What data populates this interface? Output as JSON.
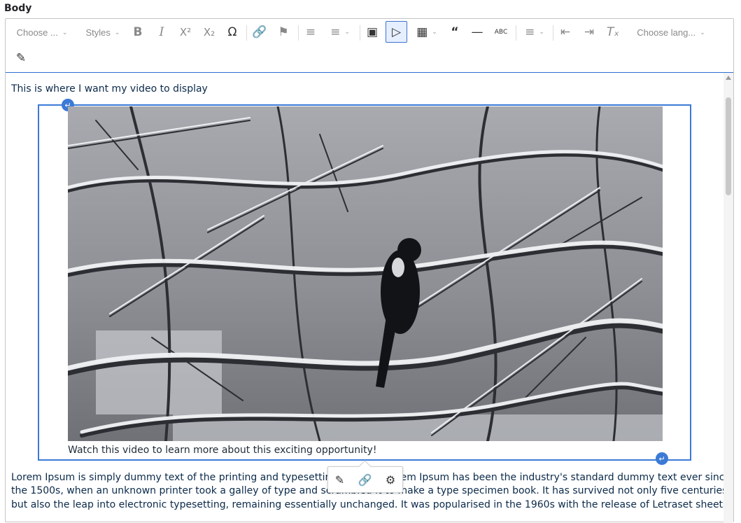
{
  "field": {
    "label": "Body"
  },
  "toolbar": {
    "heading_dropdown": "Choose ...",
    "styles_dropdown": "Styles",
    "language_dropdown": "Choose lang...",
    "icons": [
      "bold-icon",
      "italic-icon",
      "superscript-icon",
      "subscript-icon",
      "special-characters-icon",
      "link-icon",
      "anchor-flag-icon",
      "bulleted-list-icon",
      "numbered-list-icon",
      "image-icon",
      "media-play-icon",
      "table-icon",
      "block-quote-icon",
      "horizontal-line-icon",
      "source-abc-icon",
      "align-icon",
      "outdent-icon",
      "indent-icon",
      "remove-format-icon",
      "source-editing-icon"
    ]
  },
  "content": {
    "intro": "This is where I want my video to display",
    "caption": "Watch this video to learn more about this exciting opportunity!",
    "body_line1": "Lorem Ipsum is simply dummy text of the printing and typesetting industry. Lorem Ipsum has been the industry's standard dummy text ever since",
    "body_line2": "the 1500s, when an unknown printer took a galley of type and scrambled it to make a type specimen book. It has survived not only five centuries,",
    "body_line3": "but also the leap into electronic typesetting, remaining essentially unchanged. It was popularised in the 1960s with the release of Letraset sheets"
  },
  "colors": {
    "accent": "#3b7ad6",
    "text": "#0b2a4a"
  }
}
